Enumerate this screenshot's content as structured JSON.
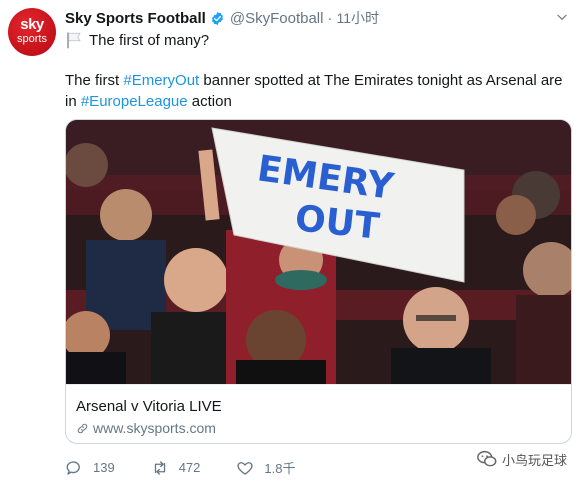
{
  "tweet": {
    "avatar": {
      "line1": "sky",
      "line2": "sports"
    },
    "display_name": "Sky Sports Football",
    "handle": "@SkyFootball",
    "separator": "·",
    "time": "11小时",
    "line1_text": "The first of many?",
    "body": {
      "p1": "The first ",
      "hashtag1": "#EmeryOut",
      "p2": " banner spotted at The Emirates tonight as Arsenal are in ",
      "hashtag2": "#EuropeLeague",
      "p3": " action"
    },
    "card": {
      "banner_line1": "EMERY",
      "banner_line2": "OUT",
      "title": "Arsenal v Vitoria LIVE",
      "url": "www.skysports.com"
    },
    "actions": {
      "replies": "139",
      "retweets": "472",
      "likes": "1.8千"
    },
    "colors": {
      "hashtag": "#1b95e0",
      "verified": "#1da1f2",
      "brand": "#e3262e"
    }
  },
  "watermark": {
    "text": "小鸟玩足球"
  }
}
